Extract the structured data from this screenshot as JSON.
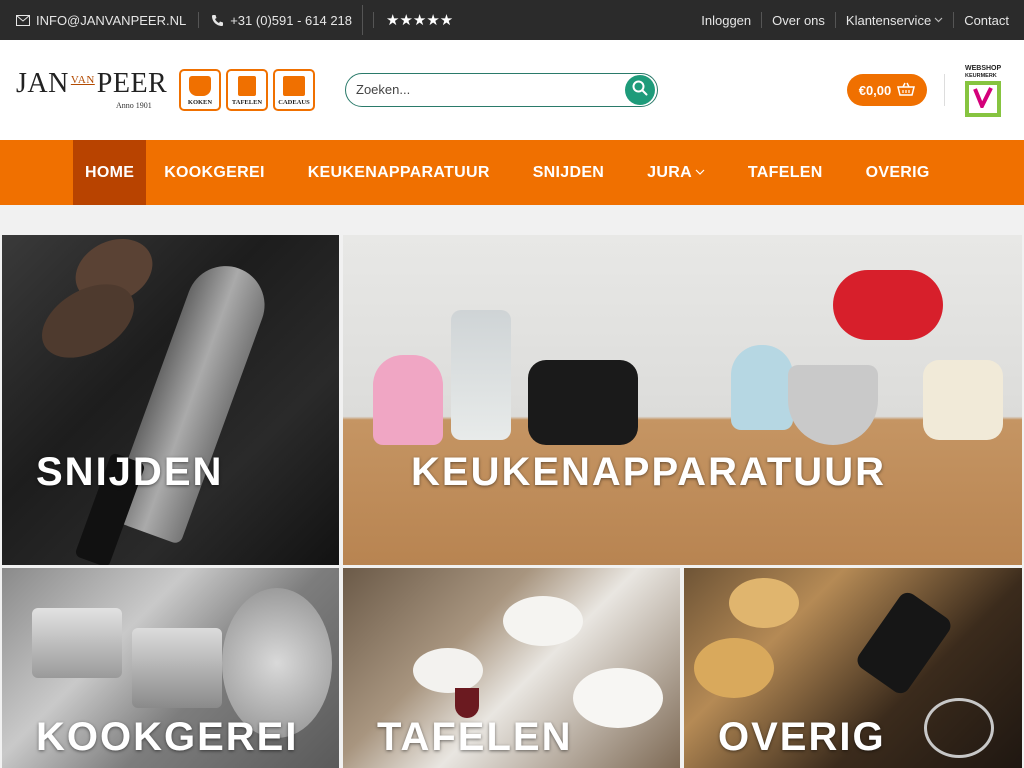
{
  "topbar": {
    "email": "INFO@JANVANPEER.NL",
    "phone": "+31 (0)591 - 614 218",
    "stars": "★★★★★",
    "links": {
      "login": "Inloggen",
      "about": "Over ons",
      "service": "Klantenservice",
      "contact": "Contact"
    }
  },
  "header": {
    "logo": {
      "jan": "JAN",
      "van": "VAN",
      "peer": "PEER",
      "anno": "Anno 1901"
    },
    "badges": [
      "KOKEN",
      "TAFELEN",
      "CADEAUS"
    ],
    "search_placeholder": "Zoeken...",
    "cart_total": "€0,00",
    "keurmerk": {
      "line1": "WEBSHOP",
      "line2": "KEURMERK"
    }
  },
  "nav": {
    "items": [
      "HOME",
      "KOOKGEREI",
      "KEUKENAPPARATUUR",
      "SNIJDEN",
      "JURA",
      "TAFELEN",
      "OVERIG"
    ]
  },
  "tiles": {
    "snijden": "SNIJDEN",
    "keukenapparatuur": "KEUKENAPPARATUUR",
    "kookgerei": "KOOKGEREI",
    "tafelen": "TAFELEN",
    "overig": "OVERIG"
  },
  "colors": {
    "accent": "#f07000",
    "nav_active": "#b84300",
    "search_button": "#1e9b7a",
    "topbar": "#2b2b2b"
  }
}
